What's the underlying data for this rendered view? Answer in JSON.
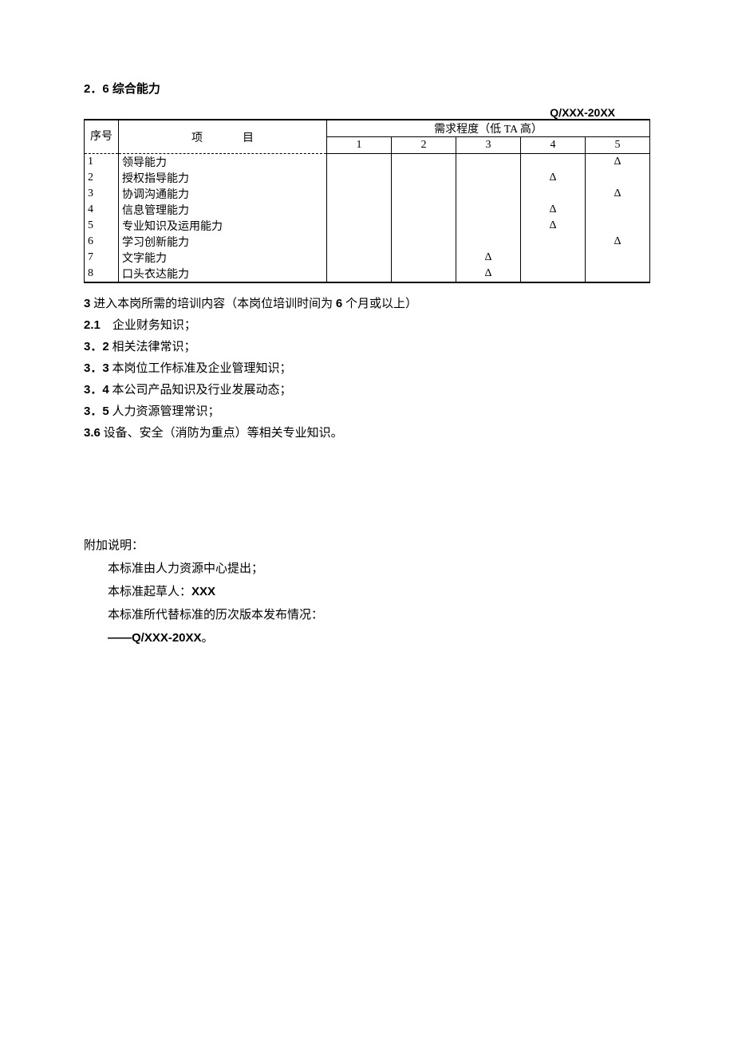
{
  "heading_2_6": "2．6 综合能力",
  "doc_code": "Q/XXX-20XX",
  "table": {
    "seq_header": "序号",
    "item_header": "项目",
    "scale_header": "需求程度（低 TA 高）",
    "cols": [
      "1",
      "2",
      "3",
      "4",
      "5"
    ],
    "rows": [
      {
        "seq": "1",
        "item": "领导能力",
        "marks": [
          "",
          "",
          "",
          "",
          "Δ"
        ]
      },
      {
        "seq": "2",
        "item": "授权指导能力",
        "marks": [
          "",
          "",
          "",
          "Δ",
          ""
        ]
      },
      {
        "seq": "3",
        "item": "协调沟通能力",
        "marks": [
          "",
          "",
          "",
          "",
          "Δ"
        ]
      },
      {
        "seq": "4",
        "item": "信息管理能力",
        "marks": [
          "",
          "",
          "",
          "Δ",
          ""
        ]
      },
      {
        "seq": "5",
        "item": "专业知识及运用能力",
        "marks": [
          "",
          "",
          "",
          "Δ",
          ""
        ]
      },
      {
        "seq": "6",
        "item": "学习创新能力",
        "marks": [
          "",
          "",
          "",
          "",
          "Δ"
        ]
      },
      {
        "seq": "7",
        "item": "文字能力",
        "marks": [
          "",
          "",
          "Δ",
          "",
          ""
        ]
      },
      {
        "seq": "8",
        "item": "口头衣达能力",
        "marks": [
          "",
          "",
          "Δ",
          "",
          ""
        ]
      }
    ]
  },
  "sec3_title_num": "3",
  "sec3_title_txt": " 进入本岗所需的培训内容（本岗位培训时间为 ",
  "sec3_title_num2": "6",
  "sec3_title_txt2": " 个月或以上）",
  "items": [
    {
      "num": "2.1",
      "txt": "　企业财务知识；"
    },
    {
      "num": "3．2",
      "txt": " 相关法律常识；"
    },
    {
      "num": "3．3",
      "txt": " 本岗位工作标准及企业管理知识；"
    },
    {
      "num": "3．4",
      "txt": " 本公司产品知识及行业发展动态；"
    },
    {
      "num": "3．5",
      "txt": " 人力资源管理常识；"
    },
    {
      "num": "3.6",
      "txt": " 设备、安全（消防为重点）等相关专业知识。"
    }
  ],
  "addendum": {
    "label": "附加说明：",
    "line1": "本标准由人力资源中心提出；",
    "line2_pre": "本标准起草人：",
    "line2_bold": "XXX",
    "line3": "本标准所代替标准的历次版本发布情况：",
    "line4_pre": "——",
    "line4_bold": "Q/XXX-20XX",
    "line4_post": "。"
  }
}
